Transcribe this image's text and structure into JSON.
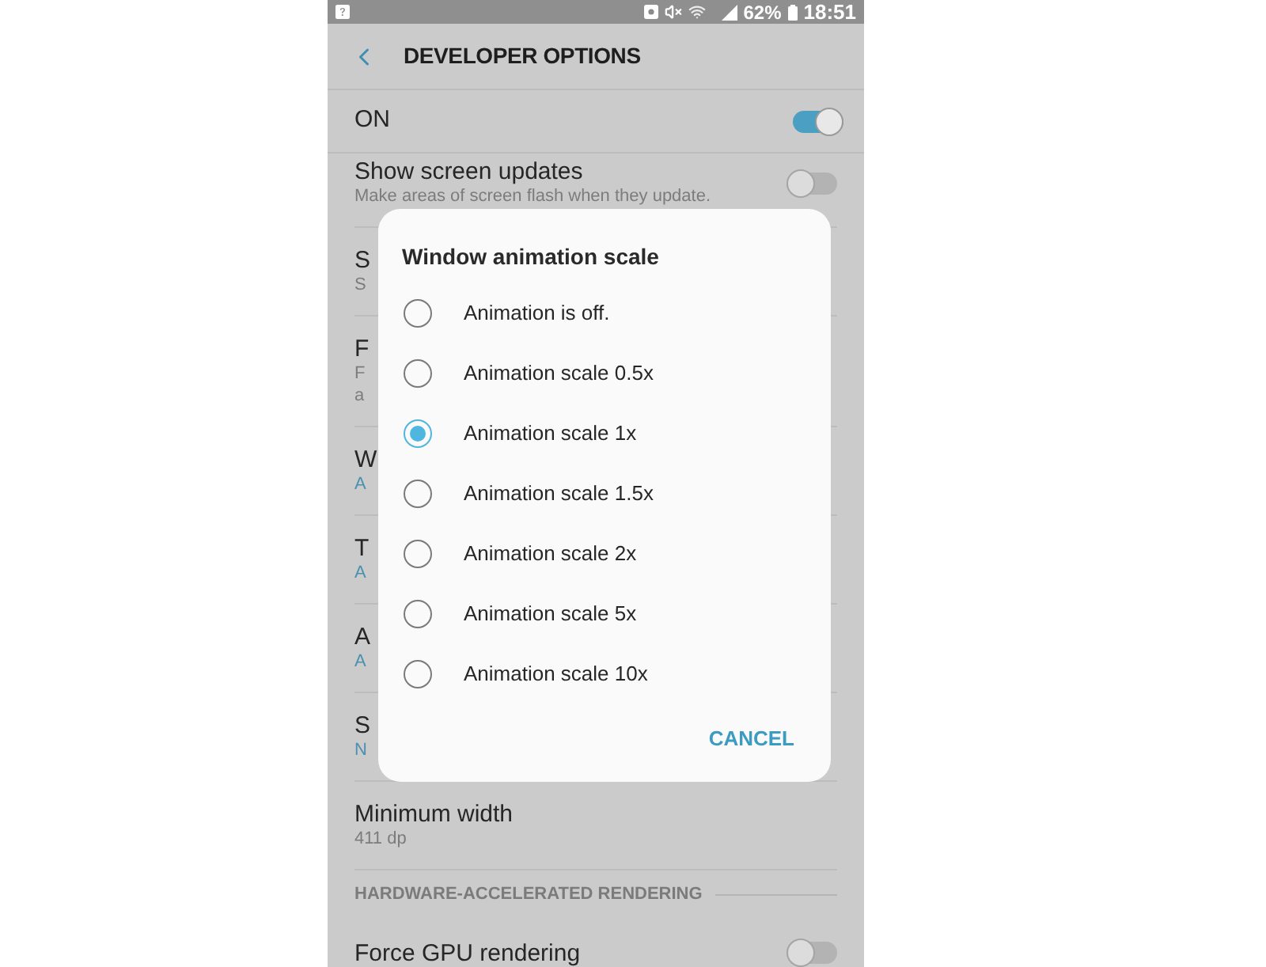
{
  "status_bar": {
    "battery": "62%",
    "time": "18:51"
  },
  "header": {
    "title": "DEVELOPER OPTIONS"
  },
  "master_switch": {
    "label": "ON",
    "on": true
  },
  "settings": [
    {
      "kind": "toggle",
      "title": "Show screen updates",
      "subtitle": "Make areas of screen flash when they update.",
      "on": false
    },
    {
      "kind": "text",
      "title": "S",
      "subtitle": "S"
    },
    {
      "kind": "text",
      "title": "F",
      "subtitle": "F\na"
    },
    {
      "kind": "value",
      "title": "W",
      "subtitle": "A"
    },
    {
      "kind": "value",
      "title": "T",
      "subtitle": "A"
    },
    {
      "kind": "value",
      "title": "A",
      "subtitle": "A"
    },
    {
      "kind": "value",
      "title": "S",
      "subtitle": "N"
    },
    {
      "kind": "text",
      "title": "Minimum width",
      "subtitle": "411 dp"
    },
    {
      "kind": "section",
      "title": "HARDWARE-ACCELERATED RENDERING"
    },
    {
      "kind": "toggle",
      "title": "Force GPU rendering",
      "on": false
    }
  ],
  "dialog": {
    "title": "Window animation scale",
    "options": [
      {
        "label": "Animation is off.",
        "selected": false
      },
      {
        "label": "Animation scale 0.5x",
        "selected": false
      },
      {
        "label": "Animation scale 1x",
        "selected": true
      },
      {
        "label": "Animation scale 1.5x",
        "selected": false
      },
      {
        "label": "Animation scale 2x",
        "selected": false
      },
      {
        "label": "Animation scale 5x",
        "selected": false
      },
      {
        "label": "Animation scale 10x",
        "selected": false
      }
    ],
    "buttons": [
      "CANCEL"
    ]
  }
}
